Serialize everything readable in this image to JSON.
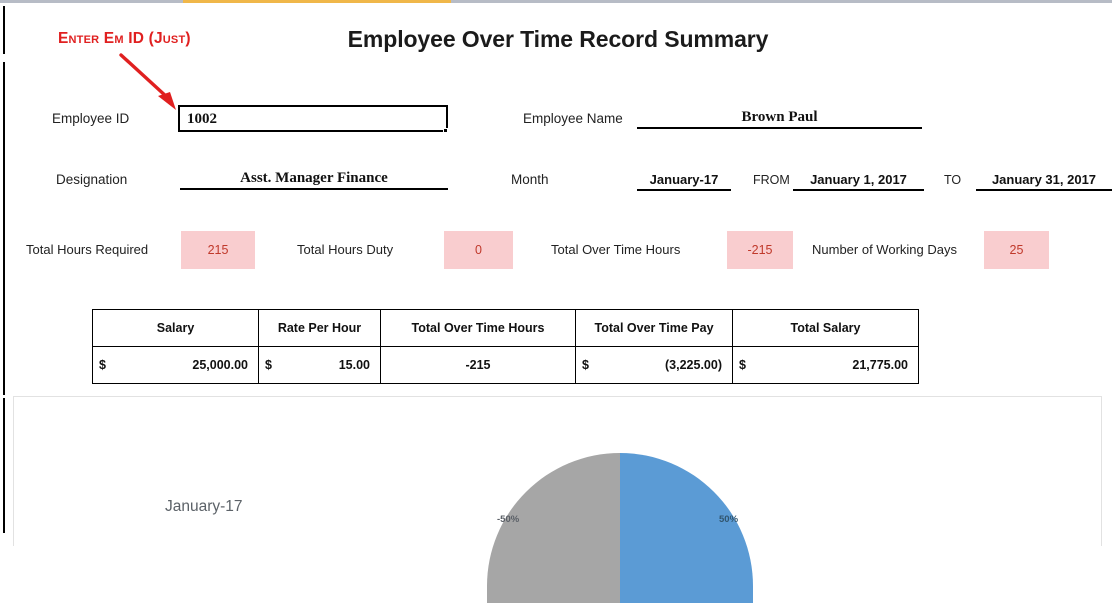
{
  "window": {
    "accent_color": "#f0b749",
    "rule_color": "#b7bcc6"
  },
  "annotation": {
    "text": "Enter Em ID (Just)",
    "color": "#e02020",
    "icon": "arrow-down-right-icon"
  },
  "header": {
    "title": "Employee Over Time Record Summary"
  },
  "form": {
    "employee_id": {
      "label": "Employee ID",
      "value": "1002",
      "placeholder": ""
    },
    "employee_name": {
      "label": "Employee Name",
      "value": "Brown Paul"
    },
    "designation": {
      "label": "Designation",
      "value": "Asst. Manager Finance"
    },
    "month": {
      "label": "Month",
      "value": "January-17"
    },
    "from": {
      "label": "FROM",
      "value": "January 1, 2017"
    },
    "to": {
      "label": "TO",
      "value": "January 31, 2017"
    }
  },
  "stats": {
    "chip_bg": "#f9cdcf",
    "chip_fg": "#c0392b",
    "items": [
      {
        "label": "Total Hours Required",
        "value": "215"
      },
      {
        "label": "Total Hours Duty",
        "value": "0"
      },
      {
        "label": "Total Over Time Hours",
        "value": "-215"
      },
      {
        "label": "Number of Working Days",
        "value": "25"
      }
    ]
  },
  "salary_table": {
    "columns": [
      "Salary",
      "Rate Per Hour",
      "Total Over Time Hours",
      "Total Over Time Pay",
      "Total Salary"
    ],
    "row": {
      "salary": {
        "currency": "$",
        "amount": "25,000.00"
      },
      "rate_per_hour": {
        "currency": "$",
        "amount": "15.00"
      },
      "total_over_time_hours": "-215",
      "total_over_time_pay": {
        "currency": "$",
        "amount": "(3,225.00)"
      },
      "total_salary": {
        "currency": "$",
        "amount": "21,775.00"
      }
    }
  },
  "chart_data": {
    "type": "pie",
    "title": "",
    "category_label": "January-17",
    "labels": [
      "Total Hours Duty",
      "Total Over Time Hours"
    ],
    "slice_text": [
      "-50%",
      "50%"
    ],
    "values": [
      -50,
      50
    ],
    "colors": [
      "#a6a6a6",
      "#5b9bd5"
    ],
    "legend": "none",
    "grid": false,
    "notes": "Half-visible pie; left half grey labelled -50%, right half blue labelled 50%"
  }
}
